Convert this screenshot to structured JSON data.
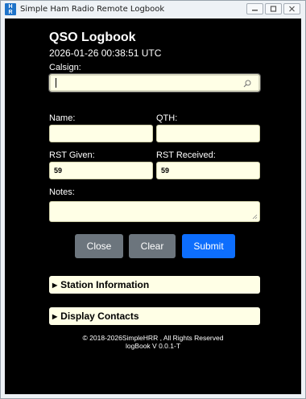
{
  "window": {
    "title": "Simple Ham Radio Remote Logbook",
    "icon_text_top": "H",
    "icon_text_bottom": "R"
  },
  "header": {
    "title": "QSO Logbook",
    "datetime": "2026-01-26 00:38:51 UTC"
  },
  "form": {
    "callsign_label": "Calsign:",
    "callsign_value": "",
    "name_label": "Name:",
    "name_value": "",
    "qth_label": "QTH:",
    "qth_value": "",
    "rst_given_label": "RST Given:",
    "rst_given_value": "59",
    "rst_received_label": "RST Received:",
    "rst_received_value": "59",
    "notes_label": "Notes:",
    "notes_value": ""
  },
  "buttons": {
    "close": "Close",
    "clear": "Clear",
    "submit": "Submit"
  },
  "panels": {
    "station_information": "Station Information",
    "display_contacts": "Display Contacts"
  },
  "footer": {
    "copyright": "© 2018-2026SimpleHRR , All Rights Reserved",
    "version": "logBook V 0.0.1-T"
  },
  "colors": {
    "background": "#000000",
    "field_background": "#ffffe6",
    "button_gray": "#6c757d",
    "button_blue": "#0d6efd"
  }
}
